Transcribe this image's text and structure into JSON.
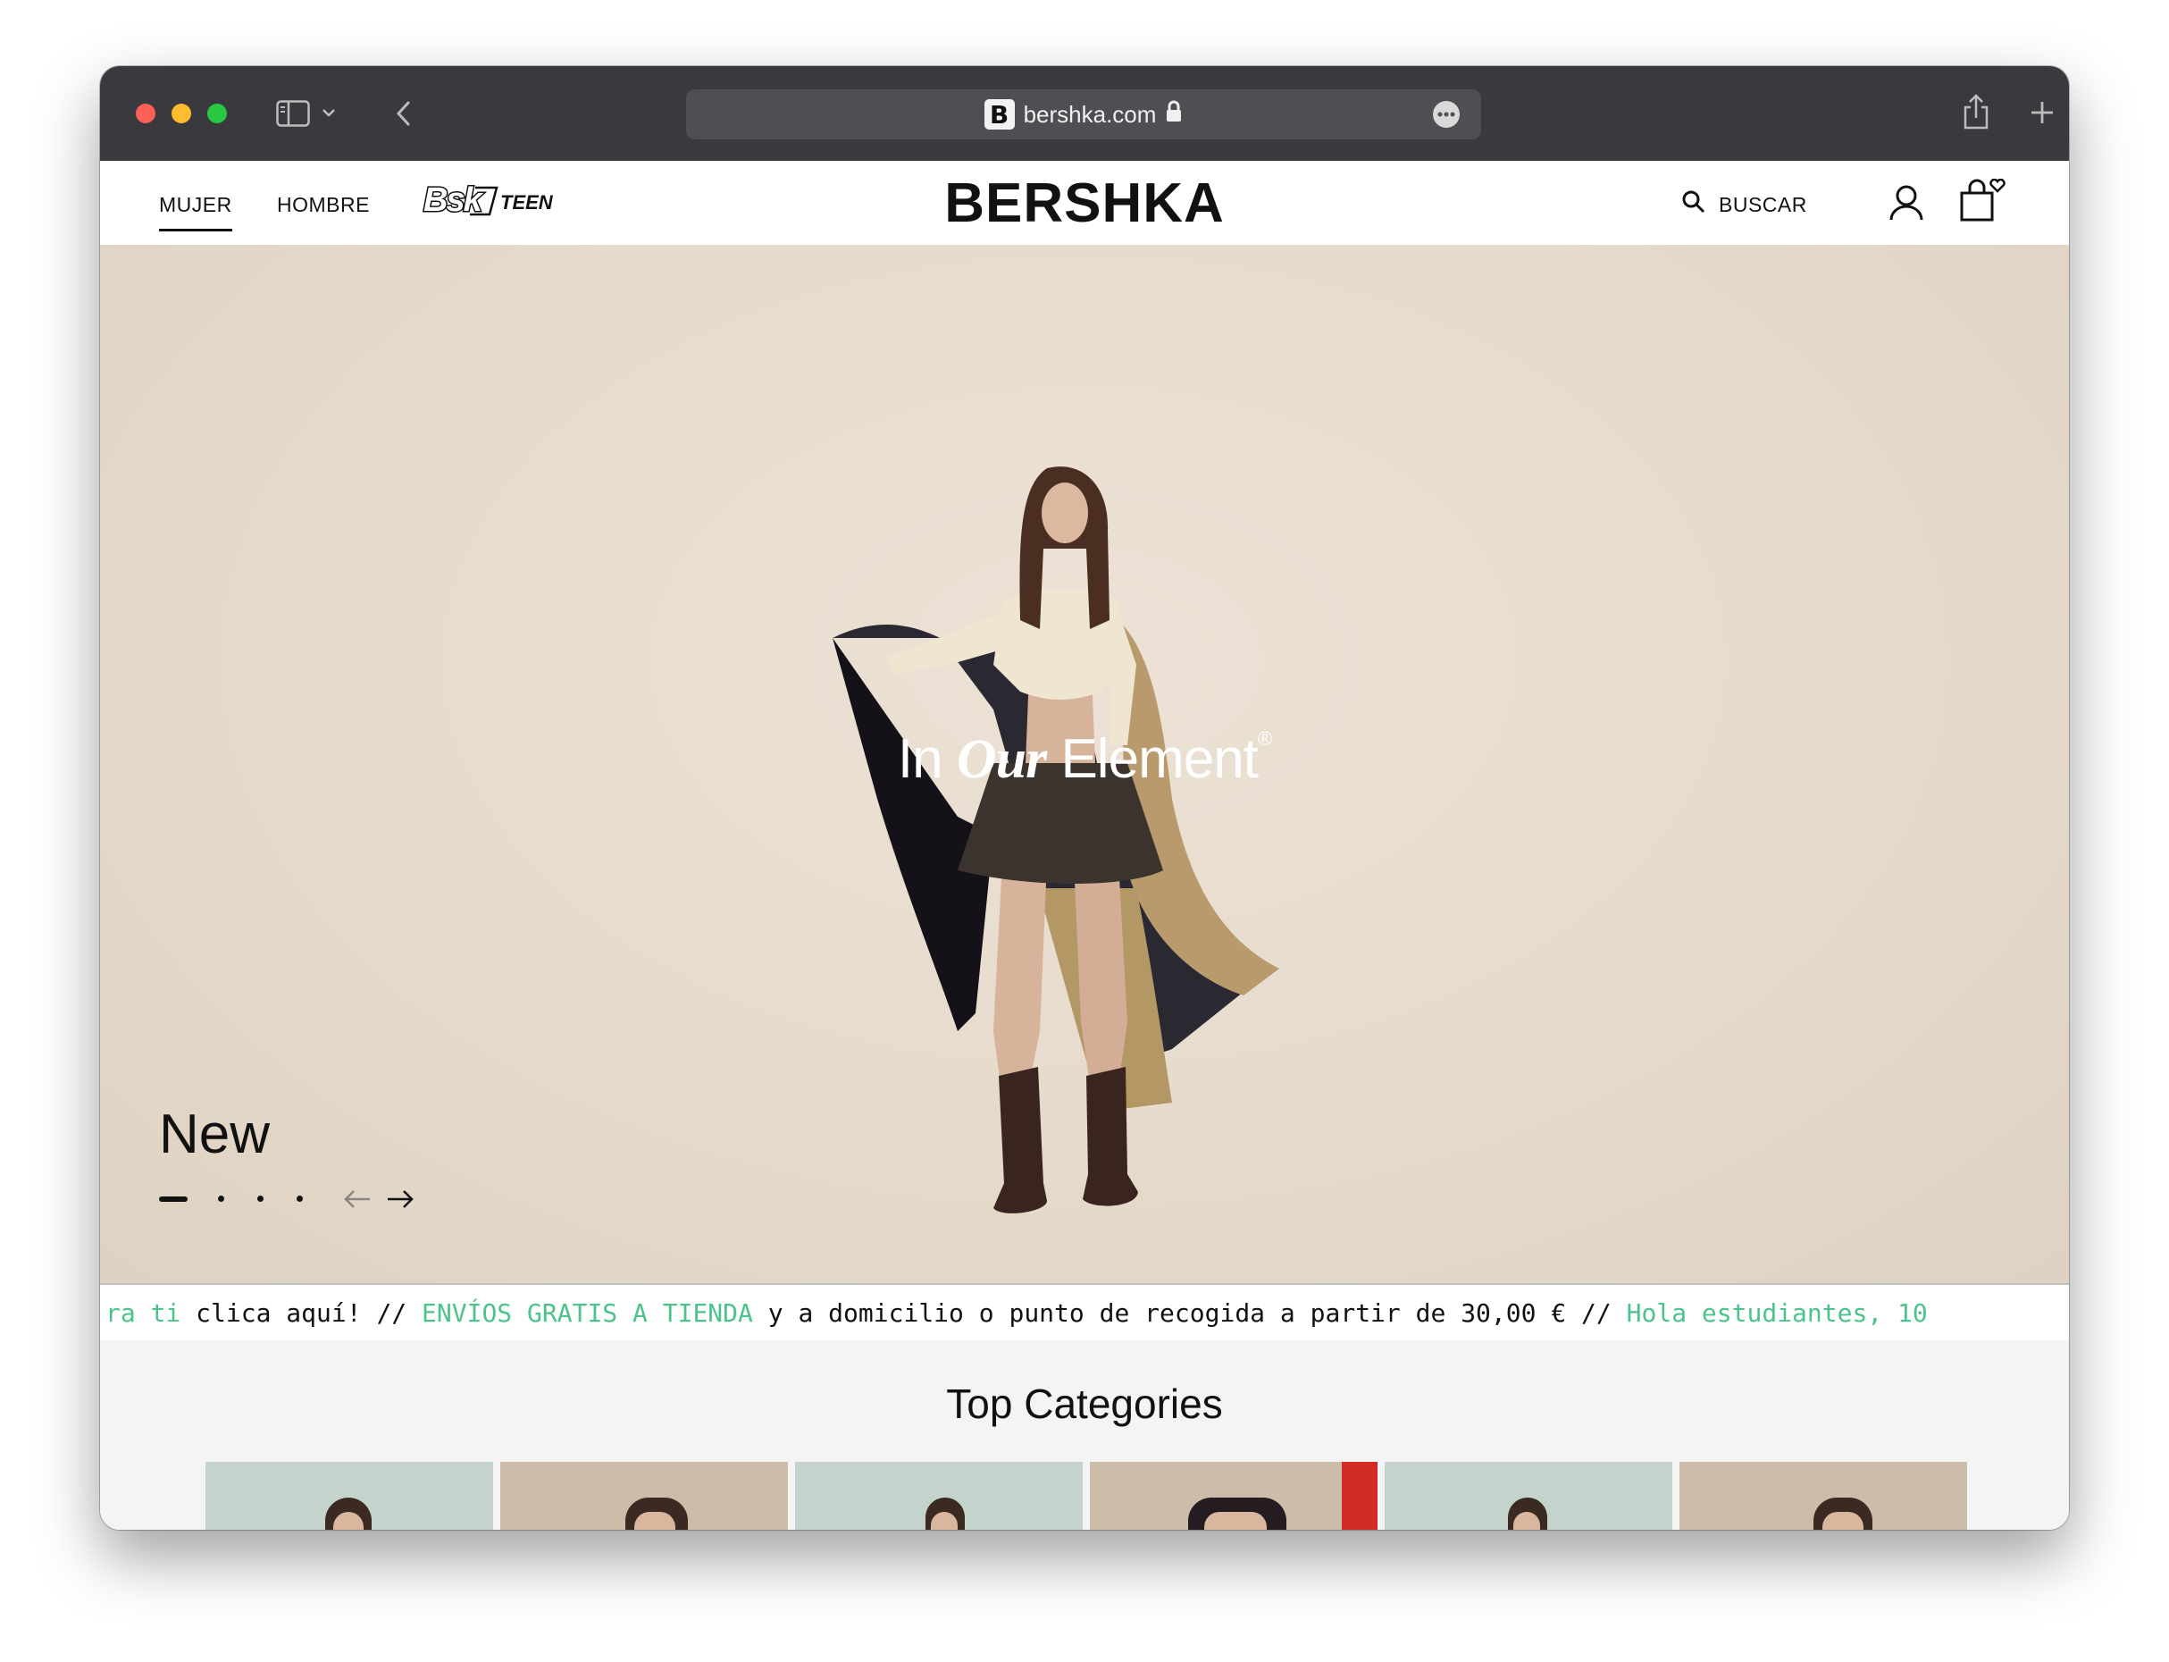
{
  "browser": {
    "url": "bershka.com",
    "favicon_letter": "B"
  },
  "header": {
    "nav": [
      "MUJER",
      "HOMBRE"
    ],
    "teen_logo": "Bsk TEEN",
    "brand": "BERSHKA",
    "search_label": "BUSCAR"
  },
  "hero": {
    "title": "New",
    "tagline": {
      "part1": "In",
      "part2": "Our",
      "part3": "Element",
      "mark": "®"
    },
    "slides_total": 4,
    "active_slide": 1
  },
  "marquee": {
    "segments": [
      {
        "text": "ra ti",
        "color": "green"
      },
      {
        "text": " clica aquí!  //  ",
        "color": "black"
      },
      {
        "text": "ENVÍOS GRATIS A TIENDA",
        "color": "green"
      },
      {
        "text": " y a domicilio o punto de recogida a partir de 30,00 €  //  ",
        "color": "black"
      },
      {
        "text": "Hola estudiantes, 10",
        "color": "green"
      }
    ]
  },
  "categories": {
    "title": "Top Categories",
    "cards": [
      "mint",
      "beige",
      "mint",
      "beige",
      "mint",
      "beige"
    ]
  },
  "colors": {
    "accent_green": "#4cc38a",
    "toolbar": "#3a393d",
    "hero_bg": "#e6dacb"
  }
}
